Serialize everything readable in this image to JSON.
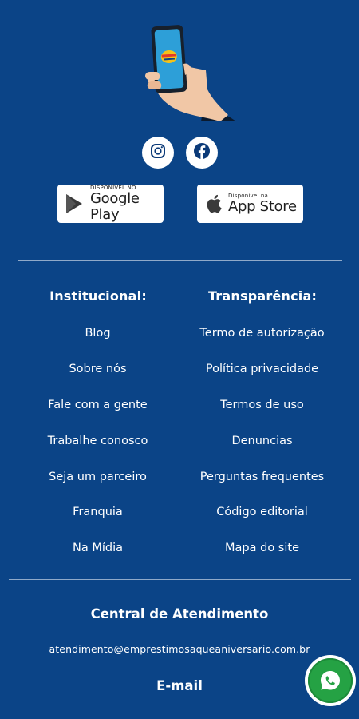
{
  "hero": {
    "phone_screen_color": "#2d9fd8",
    "brand_color": "#f4c21a"
  },
  "social": {
    "icons": [
      "instagram-icon",
      "facebook-icon"
    ]
  },
  "stores": {
    "google": {
      "small": "DISPONÍVEL NO",
      "big": "Google Play"
    },
    "apple": {
      "small": "Disponível na",
      "big": "App Store"
    }
  },
  "institucional": {
    "title": "Institucional:",
    "links": [
      "Blog",
      "Sobre nós",
      "Fale com a gente",
      "Trabalhe conosco",
      "Seja um parceiro",
      "Franquia",
      "Na Mídia"
    ]
  },
  "transparencia": {
    "title": "Transparência:",
    "links": [
      "Termo de autorização",
      "Política privacidade",
      "Termos de uso",
      "Denuncias",
      "Perguntas frequentes",
      "Código editorial",
      "Mapa do site"
    ]
  },
  "atendimento": {
    "title": "Central de Atendimento",
    "email": "atendimento@emprestimosaqueaniversario.com.br"
  },
  "email_section": {
    "title": "E-mail"
  },
  "whatsapp": {
    "icon": "whatsapp-icon",
    "color": "#25a244"
  },
  "colors": {
    "background": "#0b4487",
    "text": "#ffffff"
  }
}
